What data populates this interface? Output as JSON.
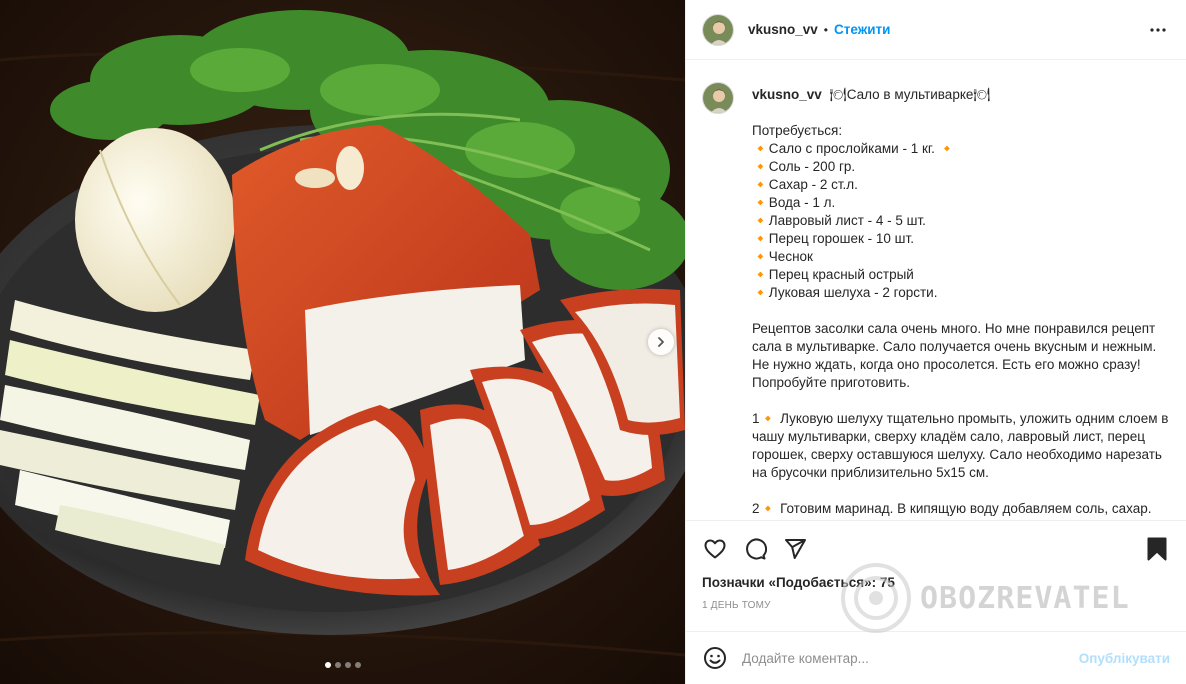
{
  "post": {
    "username": "vkusno_vv",
    "separator": "•",
    "follow_label": "Стежити",
    "more_icon": "more-horizontal-icon"
  },
  "caption": {
    "title": "🍽Сало в мультиварке🍽",
    "lines": [
      "Потребується:",
      "🔸Сало с прослойками - 1 кг. 🔸",
      "🔸Соль - 200 гр.",
      "🔸Сахар - 2 ст.л.",
      "🔸Вода - 1 л.",
      "🔸Лавровый лист - 4 - 5 шт.",
      "🔸Перец горошек - 10 шт.",
      "🔸Чеснок",
      "🔸Перец красный острый",
      "🔸Луковая шелуха - 2 горсти."
    ],
    "paragraph_1": "Рецептов засолки сала очень много. Но мне понравился рецепт сала в мультиварке. Сало получается очень вкусным и нежным. Не нужно ждать, когда оно просолется. Есть его можно сразу! Попробуйте приготовить.",
    "step_1": "1🔸 Луковую шелуху тщательно промыть, уложить одним слоем в чашу мультиварки, сверху кладём сало, лавровый лист, перец горошек, сверху оставшуюся шелуху. Сало необходимо нарезать на брусочки приблизительно 5х15 см.",
    "step_2": "2🔸 Готовим маринад. В кипящую воду добавляем соль, сахар."
  },
  "actions": {
    "icons": [
      "heart-icon",
      "comment-icon",
      "share-icon",
      "bookmark-icon"
    ]
  },
  "likes": {
    "label": "Позначки «Подобається»:",
    "count": "75"
  },
  "timestamp": "1 ДЕНЬ ТОМУ",
  "comment": {
    "placeholder": "Додайте коментар...",
    "publish_label": "Опублікувати"
  },
  "carousel": {
    "total": 4,
    "active_index": 0
  },
  "watermark": {
    "text": "OBOZREVATEL"
  },
  "colors": {
    "follow": "#0095f6",
    "publish_disabled": "#b2dffc",
    "muted": "#8e8e8e",
    "text": "#262626"
  }
}
